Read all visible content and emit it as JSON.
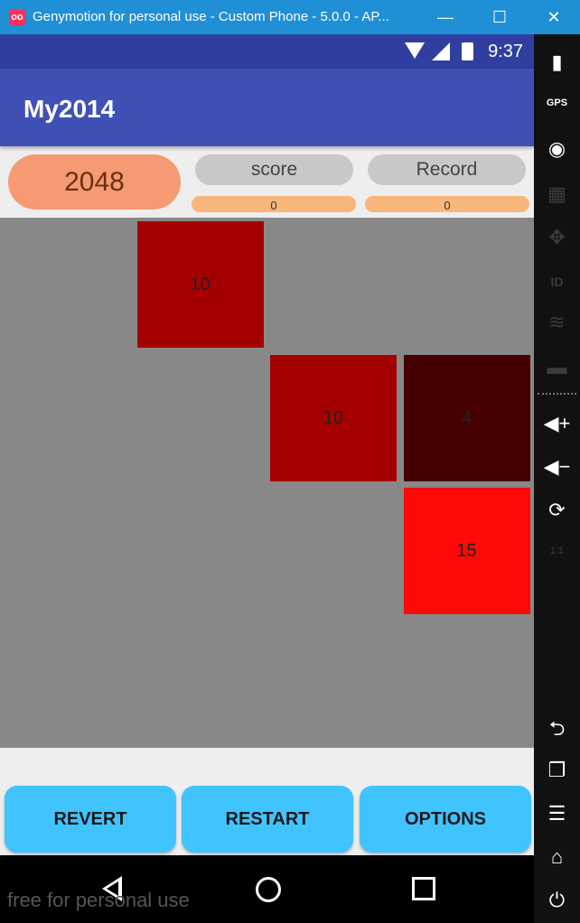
{
  "window": {
    "title": "Genymotion for personal use - Custom Phone - 5.0.0 - AP...",
    "minimize_glyph": "—",
    "maximize_glyph": "☐",
    "close_glyph": "✕"
  },
  "statusbar": {
    "time": "9:37"
  },
  "appbar": {
    "title": "My2014"
  },
  "header": {
    "logo": "2048",
    "score_label": "score",
    "score_value": "0",
    "record_label": "Record",
    "record_value": "0"
  },
  "board": {
    "tiles": [
      {
        "value": "10",
        "color": "#a50000",
        "row": 0,
        "col": 1
      },
      {
        "value": "10",
        "color": "#a50000",
        "row": 1,
        "col": 2
      },
      {
        "value": "4",
        "color": "#470000",
        "row": 1,
        "col": 3
      },
      {
        "value": "15",
        "color": "#ff0808",
        "row": 2,
        "col": 3
      }
    ]
  },
  "buttons": {
    "revert": "REVERT",
    "restart": "RESTART",
    "options": "OPTIONS"
  },
  "watermark": "free for personal use",
  "sidebar": {
    "icons": [
      "battery-icon",
      "gps-icon",
      "webcam-icon",
      "video-capture-icon",
      "dpad-icon",
      "id-icon",
      "network-icon",
      "sms-icon",
      "volume-up-icon",
      "volume-down-icon",
      "rotate-icon",
      "pixel-perfect-icon",
      "back-icon",
      "recent-apps-icon",
      "menu-icon",
      "home-icon",
      "power-icon"
    ],
    "gps_label": "GPS",
    "id_label": "ID",
    "pixel_perfect_label": "1:1"
  },
  "colors": {
    "titlebar": "#1f8fd6",
    "statusbar": "#303f9f",
    "appbar": "#3f51b5",
    "logo_bg": "#f59a72",
    "score_pill": "#c8c8c8",
    "score_bar": "#f8b77a",
    "board": "#888888",
    "button": "#40c4ff"
  }
}
